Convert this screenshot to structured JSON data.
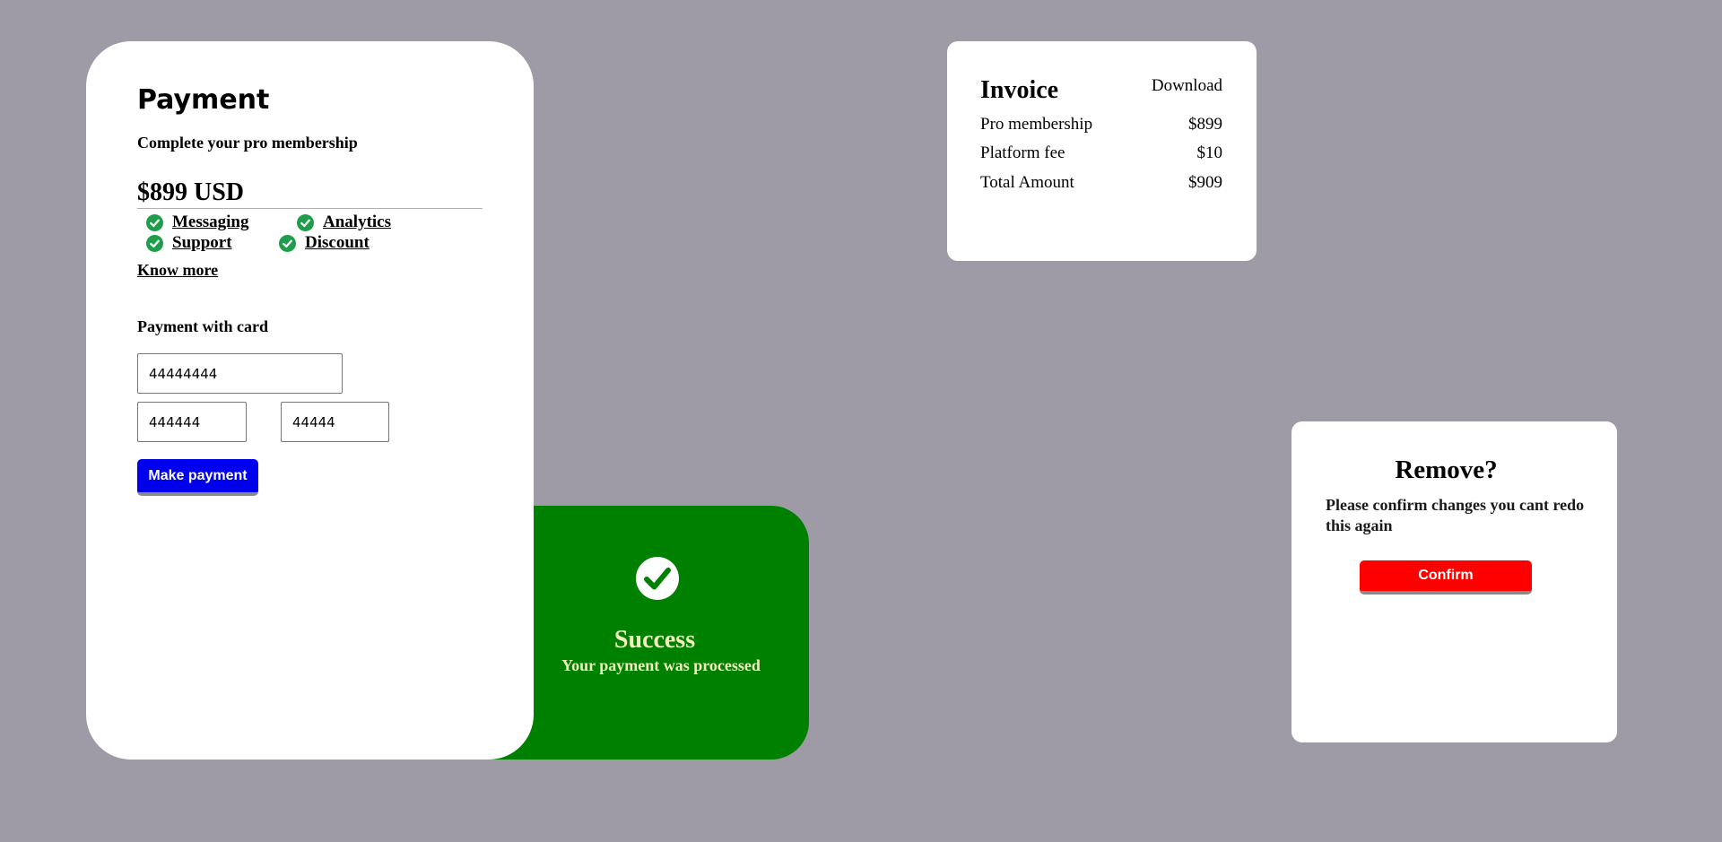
{
  "payment": {
    "title": "Payment",
    "subtitle": "Complete your pro membership",
    "price": "$899 USD",
    "features": [
      {
        "label": "Messaging",
        "icon": "check-circle-icon"
      },
      {
        "label": "Analytics",
        "icon": "check-circle-icon"
      },
      {
        "label": "Support",
        "icon": "check-circle-icon"
      },
      {
        "label": "Discount",
        "icon": "check-circle-icon"
      }
    ],
    "know_more": "Know more",
    "card_heading": "Payment with card",
    "card_number": "44444444",
    "expiry": "444444",
    "cvv": "44444",
    "button_label": "Make payment"
  },
  "success": {
    "icon": "check-circle-icon",
    "title": "Success",
    "message": "Your payment was processed"
  },
  "invoice": {
    "title": "Invoice",
    "download_label": "Download",
    "rows": [
      {
        "label": "Pro membership",
        "amount": "$899"
      },
      {
        "label": "Platform fee",
        "amount": "$10"
      },
      {
        "label": "Total Amount",
        "amount": "$909"
      }
    ]
  },
  "remove_dialog": {
    "title": "Remove?",
    "message": "Please confirm changes you cant redo this again",
    "confirm_label": "Confirm"
  },
  "colors": {
    "background": "#9e9ba6",
    "success_green": "#008000",
    "success_text": "#f2edbf",
    "check_green": "#1e9e4a",
    "pay_button": "#0000ee",
    "confirm_button": "#ff0000"
  }
}
